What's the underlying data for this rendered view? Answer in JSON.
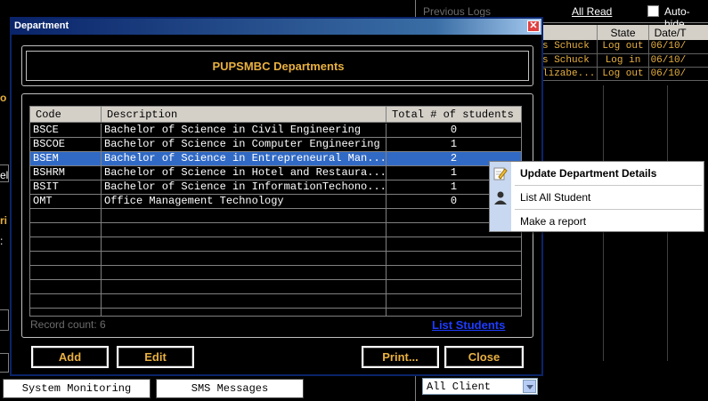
{
  "background": {
    "left_fragments": [
      "o",
      "el",
      "ri",
      ":"
    ],
    "log_panel": {
      "previous_logs": "Previous Logs",
      "all_read": "All Read",
      "auto_hide": "Auto-hide",
      "columns": [
        "",
        "State",
        "Date/T"
      ],
      "rows": [
        {
          "name": "s Schuck",
          "state": "Log out",
          "date": "06/10/"
        },
        {
          "name": "s Schuck",
          "state": "Log in",
          "date": "06/10/"
        },
        {
          "name": "lizabe...",
          "state": "Log out",
          "date": "06/10/"
        }
      ]
    },
    "client_select": "All Client",
    "bottom_buttons": [
      "System Monitoring",
      "SMS Messages"
    ]
  },
  "dialog": {
    "title": "Department",
    "close_glyph": "✕",
    "header": "PUPSMBC Departments",
    "columns": {
      "code": "Code",
      "description": "Description",
      "total": "Total # of students"
    },
    "rows": [
      {
        "code": "BSCE",
        "description": "Bachelor of Science in Civil Engineering",
        "total": "0",
        "selected": false
      },
      {
        "code": "BSCOE",
        "description": "Bachelor of Science in Computer Engineering",
        "total": "1",
        "selected": false
      },
      {
        "code": "BSEM",
        "description": "Bachelor of Science in Entrepreneural Man...",
        "total": "2",
        "selected": true
      },
      {
        "code": "BSHRM",
        "description": "Bachelor of Science in Hotel and Restaura...",
        "total": "1",
        "selected": false
      },
      {
        "code": "BSIT",
        "description": "Bachelor of Science in InformationTechono...",
        "total": "1",
        "selected": false
      },
      {
        "code": "OMT",
        "description": "Office Management Technology",
        "total": "0",
        "selected": false
      }
    ],
    "record_count": "Record count: 6",
    "list_students": "List Students",
    "buttons": {
      "add": "Add",
      "edit": "Edit",
      "print": "Print...",
      "close": "Close"
    }
  },
  "context_menu": {
    "items": [
      {
        "label": "Update Department Details",
        "icon": "edit-icon",
        "bold": true
      },
      {
        "label": "List All Student",
        "icon": "person-icon",
        "bold": false
      },
      {
        "label": "Make a report",
        "icon": "",
        "bold": false
      }
    ]
  },
  "colors": {
    "accent": "#e8b040",
    "selection": "#316ac5",
    "link": "#1e3cff",
    "titlebar": "#0a246a"
  }
}
